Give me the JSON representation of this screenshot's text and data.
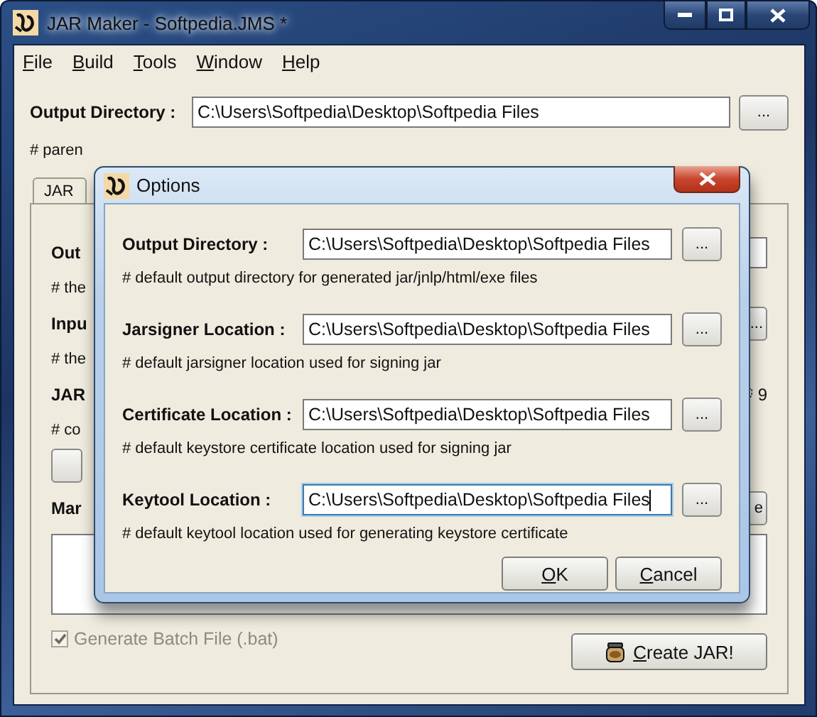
{
  "window": {
    "title": "JAR Maker - Softpedia.JMS *"
  },
  "menu": [
    {
      "label": "File",
      "underline_first": true
    },
    {
      "label": "Build",
      "underline_first": true
    },
    {
      "label": "Tools",
      "underline_first": true
    },
    {
      "label": "Window",
      "underline_first": true
    },
    {
      "label": "Help",
      "underline_first": true
    }
  ],
  "output_directory": {
    "label": "Output Directory :",
    "value": "C:\\Users\\Softpedia\\Desktop\\Softpedia Files",
    "button": "...",
    "hint": "# paren"
  },
  "tabs": [
    {
      "label": "JAR",
      "selected": true
    }
  ],
  "panel_rows": [
    {
      "kind": "field",
      "label": "Out"
    },
    {
      "kind": "hint",
      "label": "# the"
    },
    {
      "kind": "browse",
      "label": "Inpu",
      "button": "..."
    },
    {
      "kind": "hint",
      "label": "# the"
    },
    {
      "kind": "count",
      "label": "JAR",
      "count": "9"
    },
    {
      "kind": "hint",
      "label": "# co"
    },
    {
      "kind": "button"
    },
    {
      "kind": "label-button",
      "label": "Mar",
      "button": "e"
    }
  ],
  "batch_checkbox": {
    "label": "Generate Batch File (.bat)",
    "checked": true,
    "disabled": true
  },
  "create_button": {
    "label": "Create JAR!",
    "underline_first": true
  },
  "dialog": {
    "title": "Options",
    "fields": [
      {
        "label": "Output Directory :",
        "value": "C:\\Users\\Softpedia\\Desktop\\Softpedia Files",
        "button": "...",
        "hint": "# default output directory for generated jar/jnlp/html/exe files",
        "focused": false
      },
      {
        "label": "Jarsigner Location :",
        "value": "C:\\Users\\Softpedia\\Desktop\\Softpedia Files",
        "button": "...",
        "hint": "# default jarsigner location used for signing jar",
        "focused": false
      },
      {
        "label": "Certificate Location :",
        "value": "C:\\Users\\Softpedia\\Desktop\\Softpedia Files",
        "button": "...",
        "hint": "# default keystore certificate location used for signing jar",
        "focused": false
      },
      {
        "label": "Keytool Location :",
        "value": "C:\\Users\\Softpedia\\Desktop\\Softpedia Files",
        "button": "...",
        "hint": "# default keytool location used for generating keystore certificate",
        "focused": true
      }
    ],
    "buttons": [
      {
        "label": "OK",
        "underline_first": true
      },
      {
        "label": "Cancel",
        "underline_first": true
      }
    ]
  }
}
